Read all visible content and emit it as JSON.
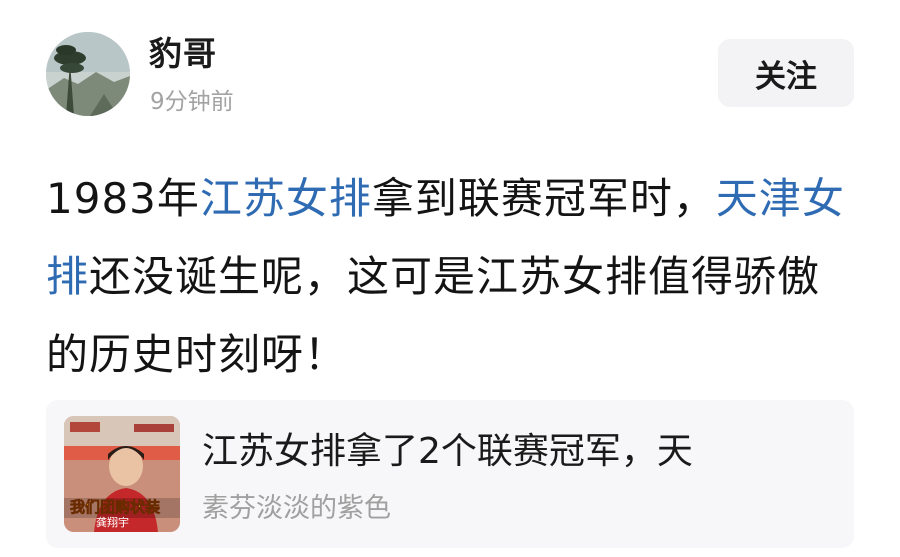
{
  "author": {
    "name": "豹哥",
    "time": "9分钟前",
    "follow_label": "关注"
  },
  "post": {
    "segments": [
      {
        "text": "1983年",
        "tag": false
      },
      {
        "text": "江苏女排",
        "tag": true
      },
      {
        "text": "拿到联赛冠军时，",
        "tag": false
      },
      {
        "text": "天津女排",
        "tag": true
      },
      {
        "text": "还没诞生呢，这可是江苏女排值得骄傲的历史时刻呀！",
        "tag": false
      }
    ],
    "tag_color": "#2f6bb3"
  },
  "shared_card": {
    "title": "江苏女排拿了2个联赛冠军，天",
    "source": "素芬淡淡的紫色",
    "thumbnail_caption": "我们团购状装",
    "thumbnail_caption_2": "龚翔宇"
  }
}
